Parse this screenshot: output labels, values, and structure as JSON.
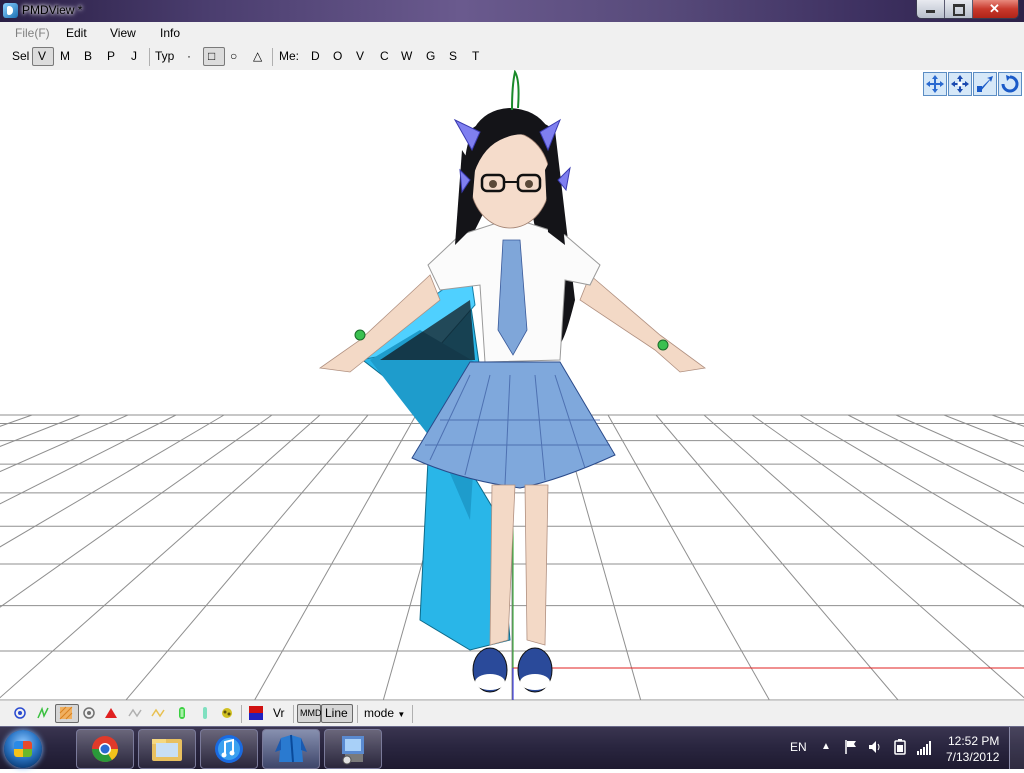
{
  "window": {
    "title": "PMDView *"
  },
  "menu": {
    "items": [
      {
        "label": "File(F)",
        "disabled": true
      },
      {
        "label": "Edit"
      },
      {
        "label": "View"
      },
      {
        "label": "Info"
      }
    ]
  },
  "toolbar": {
    "sel_label": "Sel",
    "sel_items": [
      "V",
      "M",
      "B",
      "P",
      "J"
    ],
    "typ_label": "Typ",
    "typ_items": [
      "·",
      "□",
      "○",
      "△"
    ],
    "me_label": "Me:",
    "me_items": [
      "D",
      "O",
      "V",
      "C",
      "W",
      "G",
      "S",
      "T"
    ]
  },
  "view_tools": [
    "move-xy-icon",
    "move-xyz-icon",
    "scale-icon",
    "rotate-icon"
  ],
  "bottom": {
    "vr_label": "Vr",
    "mmd_label": "MMD",
    "line_label": "Line",
    "mode_label": "mode",
    "icons": [
      "vertex-icon",
      "bone-icon",
      "material-icon",
      "rigid-icon",
      "triangle-icon",
      "morph-icon",
      "wave-icon",
      "joint-icon",
      "ik-icon",
      "physics-icon",
      "color-icon"
    ]
  },
  "taskbar": {
    "apps": [
      "chrome-icon",
      "explorer-icon",
      "itunes-icon",
      "pmdview-icon",
      "installer-icon"
    ],
    "lang": "EN",
    "time": "12:52 PM",
    "date": "7/13/2012"
  },
  "colors": {
    "accent": "#5b8dc4",
    "grid": "#8a8a8a",
    "x_axis": "#e02020",
    "y_axis": "#20a020",
    "z_axis": "#2020e0"
  }
}
